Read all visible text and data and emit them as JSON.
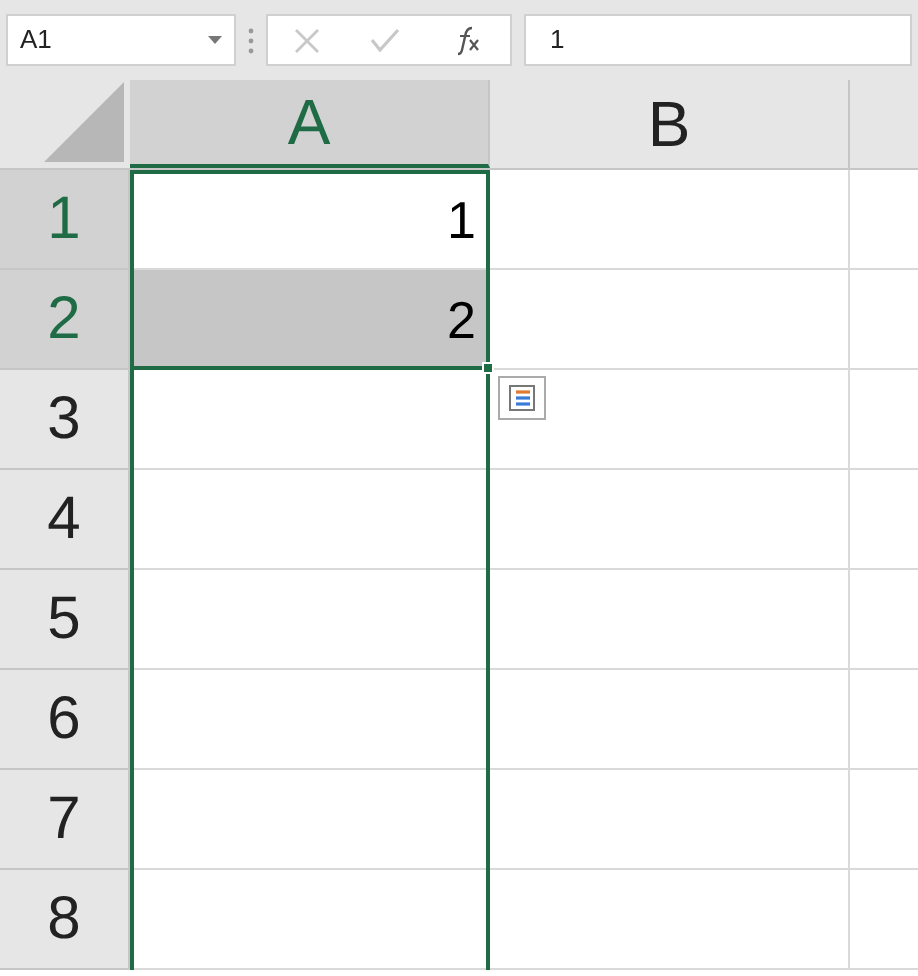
{
  "name_box": {
    "value": "A1"
  },
  "formula_bar": {
    "value": "1"
  },
  "columns": [
    {
      "label": "A",
      "selected": true
    },
    {
      "label": "B",
      "selected": false
    }
  ],
  "rows": [
    {
      "label": "1",
      "selected": true,
      "cell": {
        "text": "1",
        "highlighted": false
      }
    },
    {
      "label": "2",
      "selected": true,
      "cell": {
        "text": "2",
        "highlighted": true
      }
    },
    {
      "label": "3",
      "selected": false
    },
    {
      "label": "4",
      "selected": false
    },
    {
      "label": "5",
      "selected": false
    },
    {
      "label": "6",
      "selected": false
    },
    {
      "label": "7",
      "selected": false
    },
    {
      "label": "8",
      "selected": false
    }
  ]
}
